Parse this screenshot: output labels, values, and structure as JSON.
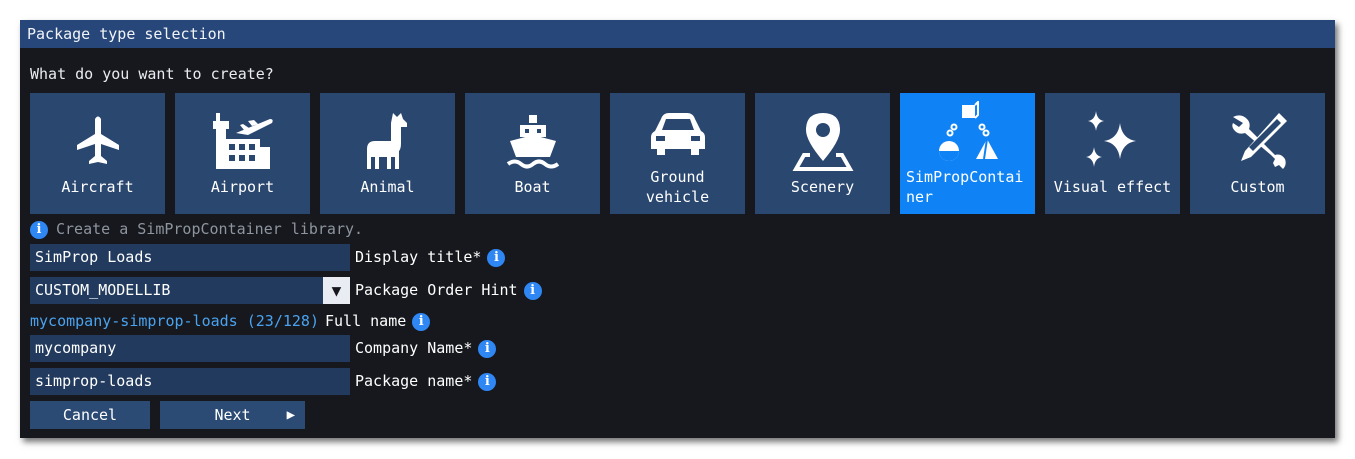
{
  "dialog": {
    "title": "Package type selection",
    "question": "What do you want to create?"
  },
  "package_types": [
    {
      "label": "Aircraft",
      "icon": "airplane-icon"
    },
    {
      "label": "Airport",
      "icon": "airport-icon"
    },
    {
      "label": "Animal",
      "icon": "llama-icon"
    },
    {
      "label": "Boat",
      "icon": "boat-icon"
    },
    {
      "label": "Ground vehicle",
      "icon": "car-icon"
    },
    {
      "label": "Scenery",
      "icon": "map-pin-icon"
    },
    {
      "label": "SimPropContainer",
      "icon": "simprop-shapes-icon",
      "selected": true
    },
    {
      "label": "Visual effect",
      "icon": "sparkle-icon"
    },
    {
      "label": "Custom",
      "icon": "tools-icon"
    }
  ],
  "description": "Create a SimPropContainer library.",
  "form": {
    "display_title": {
      "value": "SimProp Loads",
      "label": "Display title*"
    },
    "package_order_hint": {
      "value": "CUSTOM_MODELLIB",
      "label": "Package Order Hint"
    },
    "full_name": {
      "value": "mycompany-simprop-loads (23/128)",
      "label": "Full name"
    },
    "company_name": {
      "value": "mycompany",
      "label": "Company Name*"
    },
    "package_name": {
      "value": "simprop-loads",
      "label": "Package name*"
    }
  },
  "buttons": {
    "cancel": "Cancel",
    "next": "Next"
  },
  "glyphs": {
    "info": "i",
    "dropdown": "▼",
    "next_arrow": "▶"
  },
  "colors": {
    "titlebar": "#27477a",
    "background": "#16181d",
    "tile": "#2a4770",
    "tile_selected": "#0f83f5",
    "field": "#213a5e",
    "info_icon": "#2f87f4",
    "fullname_value": "#4aa3f0"
  }
}
